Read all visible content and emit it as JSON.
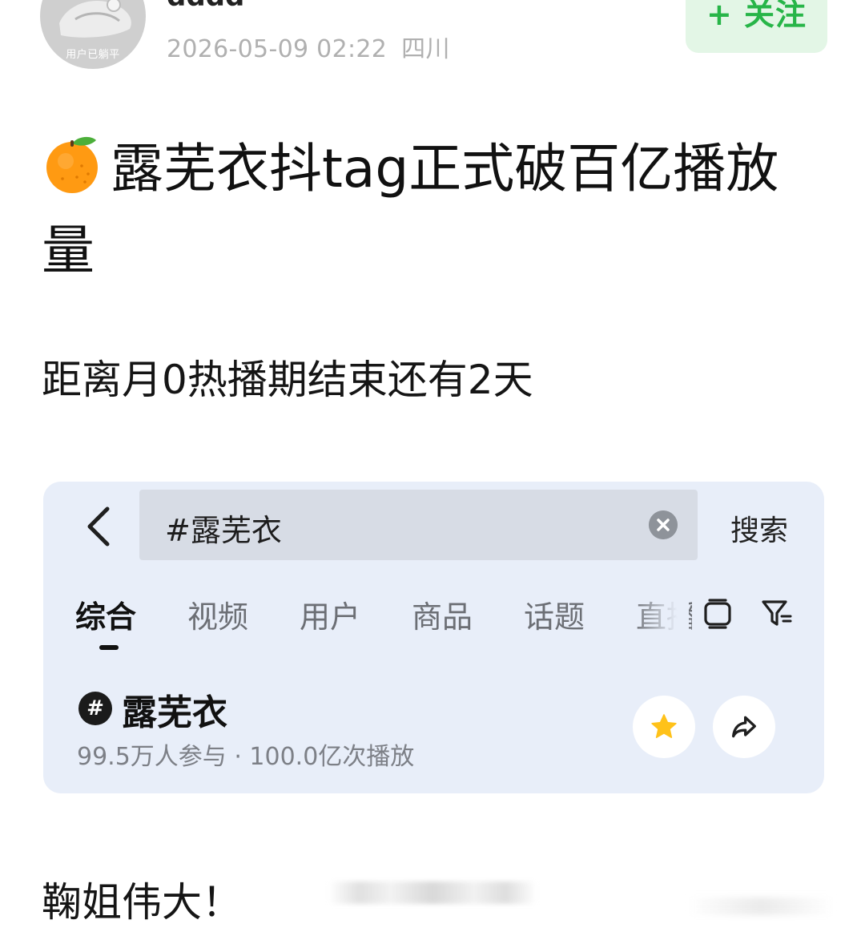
{
  "post": {
    "author": "dddd",
    "avatar_caption": "用户已躺平",
    "timestamp": "2026-05-09 02:22",
    "location": "四川",
    "follow_label": "+ 关注",
    "title": "露芜衣抖tag正式破百亿播放量",
    "title_emoji": "tangerine-icon",
    "subline": "距离月0热播期结束还有2天",
    "closing": "鞠姐伟大！"
  },
  "embedded_search": {
    "query": "#露芜衣",
    "search_label": "搜索",
    "tabs": [
      {
        "label": "综合",
        "active": true
      },
      {
        "label": "视频",
        "active": false
      },
      {
        "label": "用户",
        "active": false
      },
      {
        "label": "商品",
        "active": false
      },
      {
        "label": "话题",
        "active": false
      },
      {
        "label": "直播",
        "active": false
      }
    ],
    "topic": {
      "badge": "#",
      "name": "露芜衣",
      "stats": "99.5万人参与 · 100.0亿次播放"
    }
  },
  "colors": {
    "follow_green": "#27b548",
    "follow_bg": "#e3f6e6",
    "card_bg": "#e8eef9",
    "star": "#ffc21a"
  }
}
